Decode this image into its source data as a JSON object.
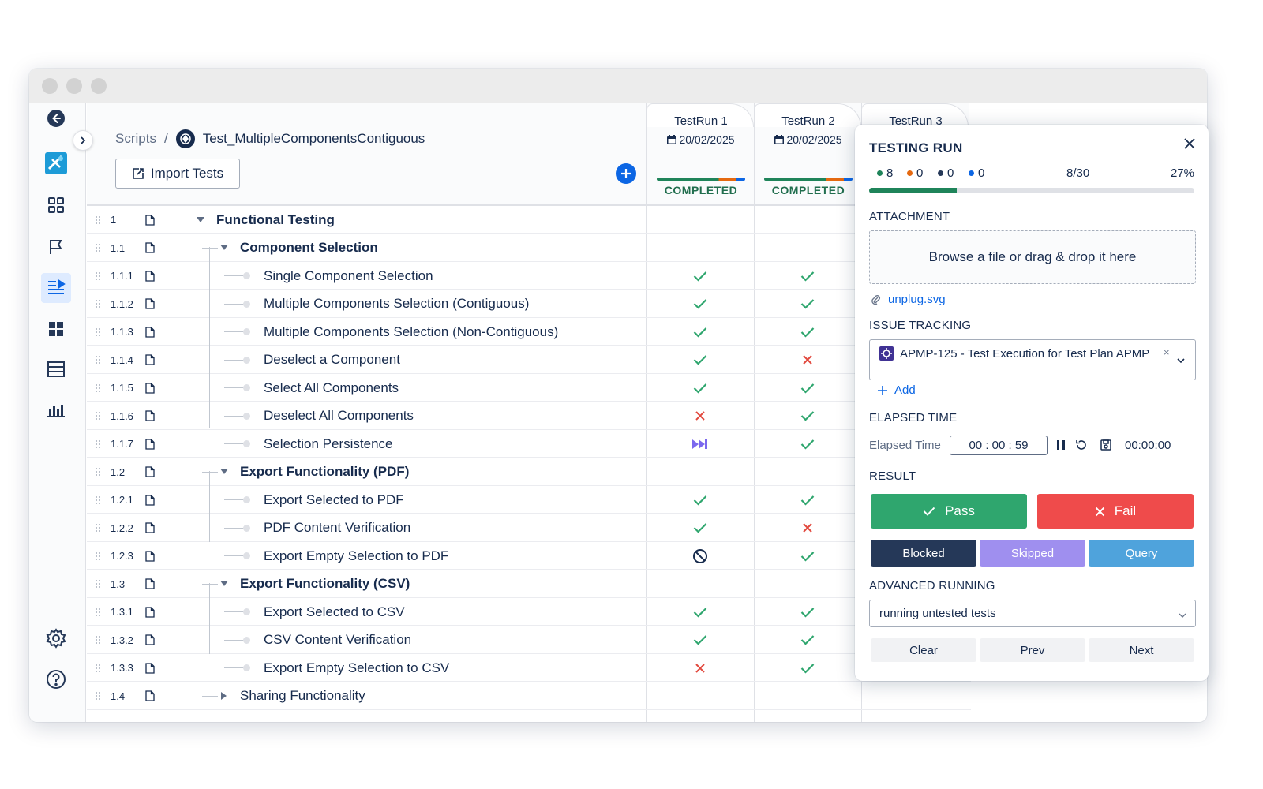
{
  "breadcrumb": {
    "parent": "Scripts",
    "separator": "/",
    "current": "Test_MultipleComponentsContiguous"
  },
  "toolbar": {
    "import_label": "Import Tests"
  },
  "runs": [
    {
      "name": "TestRun 1",
      "date": "20/02/2025",
      "status": "COMPLETED"
    },
    {
      "name": "TestRun 2",
      "date": "20/02/2025",
      "status": "COMPLETED"
    },
    {
      "name": "TestRun 3"
    }
  ],
  "rows": [
    {
      "num": "1",
      "title": "Functional Testing",
      "level": 0,
      "group": true,
      "expanded": true,
      "r1": "",
      "r2": ""
    },
    {
      "num": "1.1",
      "title": "Component Selection",
      "level": 1,
      "group": true,
      "expanded": true,
      "r1": "",
      "r2": ""
    },
    {
      "num": "1.1.1",
      "title": "Single Component Selection",
      "level": 2,
      "group": false,
      "r1": "pass",
      "r2": "pass"
    },
    {
      "num": "1.1.2",
      "title": "Multiple Components Selection (Contiguous)",
      "level": 2,
      "group": false,
      "r1": "pass",
      "r2": "pass"
    },
    {
      "num": "1.1.3",
      "title": "Multiple Components Selection (Non-Contiguous)",
      "level": 2,
      "group": false,
      "r1": "pass",
      "r2": "pass"
    },
    {
      "num": "1.1.4",
      "title": "Deselect a Component",
      "level": 2,
      "group": false,
      "r1": "pass",
      "r2": "fail"
    },
    {
      "num": "1.1.5",
      "title": "Select All Components",
      "level": 2,
      "group": false,
      "r1": "pass",
      "r2": "pass"
    },
    {
      "num": "1.1.6",
      "title": "Deselect All Components",
      "level": 2,
      "group": false,
      "r1": "fail",
      "r2": "pass"
    },
    {
      "num": "1.1.7",
      "title": "Selection Persistence",
      "level": 2,
      "group": false,
      "r1": "skipped",
      "r2": "pass"
    },
    {
      "num": "1.2",
      "title": "Export Functionality (PDF)",
      "level": 1,
      "group": true,
      "expanded": true,
      "r1": "",
      "r2": ""
    },
    {
      "num": "1.2.1",
      "title": "Export Selected to PDF",
      "level": 2,
      "group": false,
      "r1": "pass",
      "r2": "pass"
    },
    {
      "num": "1.2.2",
      "title": "PDF Content Verification",
      "level": 2,
      "group": false,
      "r1": "pass",
      "r2": "fail"
    },
    {
      "num": "1.2.3",
      "title": "Export Empty Selection to PDF",
      "level": 2,
      "group": false,
      "r1": "blocked",
      "r2": "pass"
    },
    {
      "num": "1.3",
      "title": "Export Functionality (CSV)",
      "level": 1,
      "group": true,
      "expanded": true,
      "r1": "",
      "r2": ""
    },
    {
      "num": "1.3.1",
      "title": "Export Selected to CSV",
      "level": 2,
      "group": false,
      "r1": "pass",
      "r2": "pass"
    },
    {
      "num": "1.3.2",
      "title": "CSV Content Verification",
      "level": 2,
      "group": false,
      "r1": "pass",
      "r2": "pass"
    },
    {
      "num": "1.3.3",
      "title": "Export Empty Selection to CSV",
      "level": 2,
      "group": false,
      "r1": "fail",
      "r2": "pass"
    },
    {
      "num": "1.4",
      "title": "Sharing Functionality",
      "level": 1,
      "group": true,
      "expanded": false,
      "bold": false,
      "r1": "",
      "r2": ""
    }
  ],
  "panel": {
    "title": "TESTING RUN",
    "stats": {
      "passed": "8",
      "failed": "0",
      "blocked": "0",
      "query": "0",
      "fraction": "8/30",
      "percent": "27%"
    },
    "progress": 0.27,
    "attachment_label": "ATTACHMENT",
    "dropzone_text": "Browse a file or drag & drop it here",
    "attachment_file": "unplug.svg",
    "issue_label": "ISSUE TRACKING",
    "issue_item": "APMP-125 - Test Execution for Test Plan APMP",
    "issue_remove": "×",
    "add_label": "Add",
    "elapsed_section": "ELAPSED TIME",
    "elapsed_label": "Elapsed Time",
    "elapsed_value": "00 : 00 : 59",
    "elapsed_total": "00:00:00",
    "result_label": "RESULT",
    "pass_label": "Pass",
    "fail_label": "Fail",
    "blocked_label": "Blocked",
    "skipped_label": "Skipped",
    "query_label": "Query",
    "advanced_label": "ADVANCED RUNNING",
    "advanced_value": "running untested tests",
    "clear_label": "Clear",
    "prev_label": "Prev",
    "next_label": "Next"
  },
  "colors": {
    "pass": "#1f845a",
    "fail": "#e2483d",
    "blocked": "#253858",
    "skipped": "#9f8fef",
    "query": "#4fa3dc",
    "accent": "#0c66e4"
  }
}
